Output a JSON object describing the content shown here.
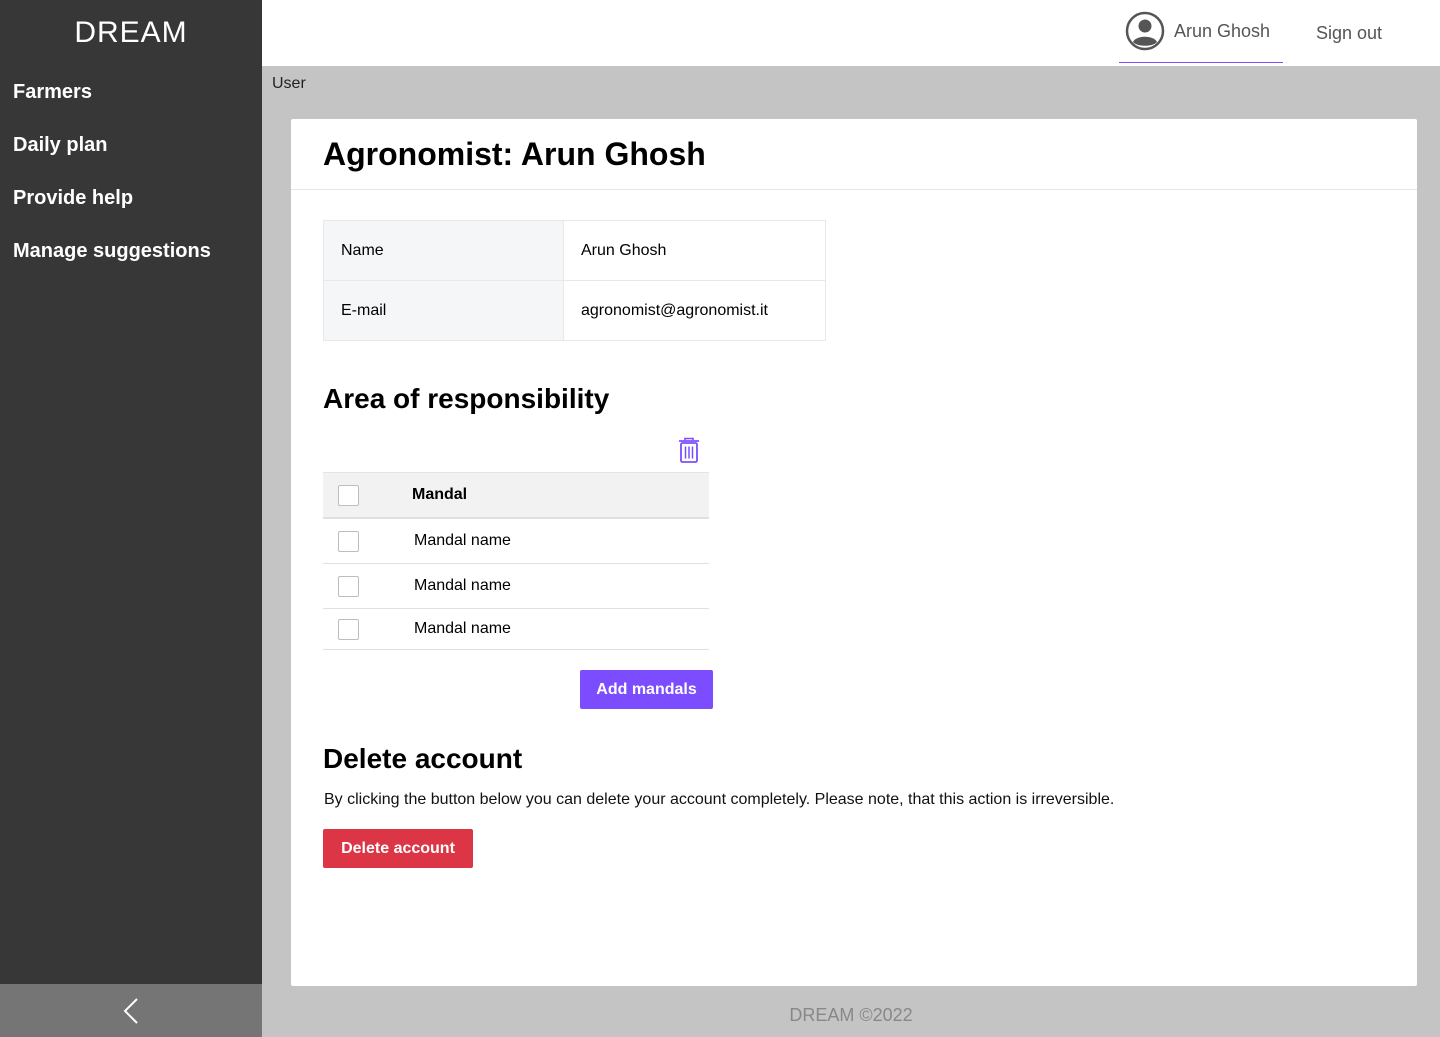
{
  "app": {
    "logo": "DREAM"
  },
  "sidebar": {
    "items": [
      {
        "label": "Farmers"
      },
      {
        "label": "Daily plan"
      },
      {
        "label": "Provide help"
      },
      {
        "label": "Manage suggestions"
      }
    ]
  },
  "header": {
    "user_name": "Arun Ghosh",
    "signout_label": "Sign out"
  },
  "breadcrumb": "User",
  "profile": {
    "title": "Agronomist: Arun Ghosh",
    "fields": [
      {
        "label": "Name",
        "value": "Arun Ghosh"
      },
      {
        "label": "E-mail",
        "value": "agronomist@agronomist.it"
      }
    ]
  },
  "area": {
    "title": "Area of responsibility",
    "column_header": "Mandal",
    "rows": [
      "Mandal name",
      "Mandal name",
      "Mandal name"
    ],
    "add_label": "Add mandals"
  },
  "delete": {
    "title": "Delete account",
    "description": "By clicking the button below you can delete your account completely. Please note, that this action is irreversible.",
    "button_label": "Delete account"
  },
  "footer": "DREAM ©2022",
  "colors": {
    "accent": "#7c4dff",
    "danger": "#dc3545",
    "sidebar": "#373737"
  },
  "icons": [
    "user-circle-icon",
    "trash-icon",
    "chevron-left-icon"
  ]
}
